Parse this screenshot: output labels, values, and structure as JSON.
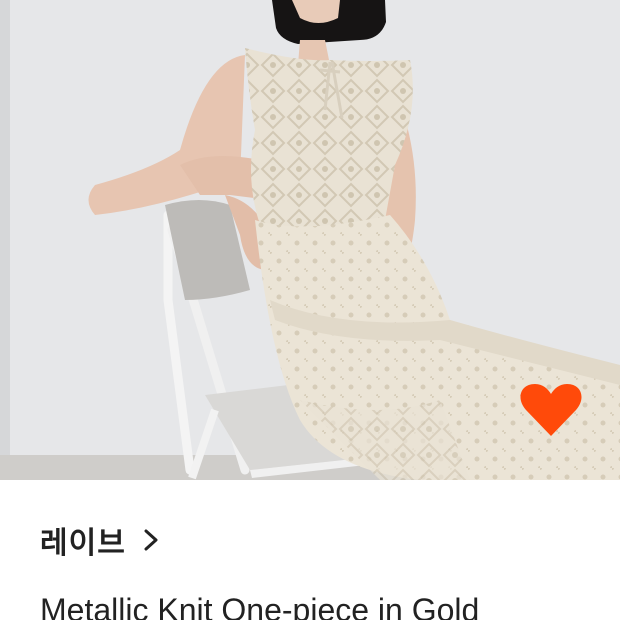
{
  "product": {
    "brand": "레이브",
    "name": "Metallic Knit One-piece in Gold",
    "wishlisted": true
  },
  "icons": {
    "wishlist": "heart-icon",
    "brand_link": "chevron-right-icon"
  },
  "colors": {
    "heart": "#ff4a0a",
    "text": "#222222",
    "background": "#ffffff"
  }
}
